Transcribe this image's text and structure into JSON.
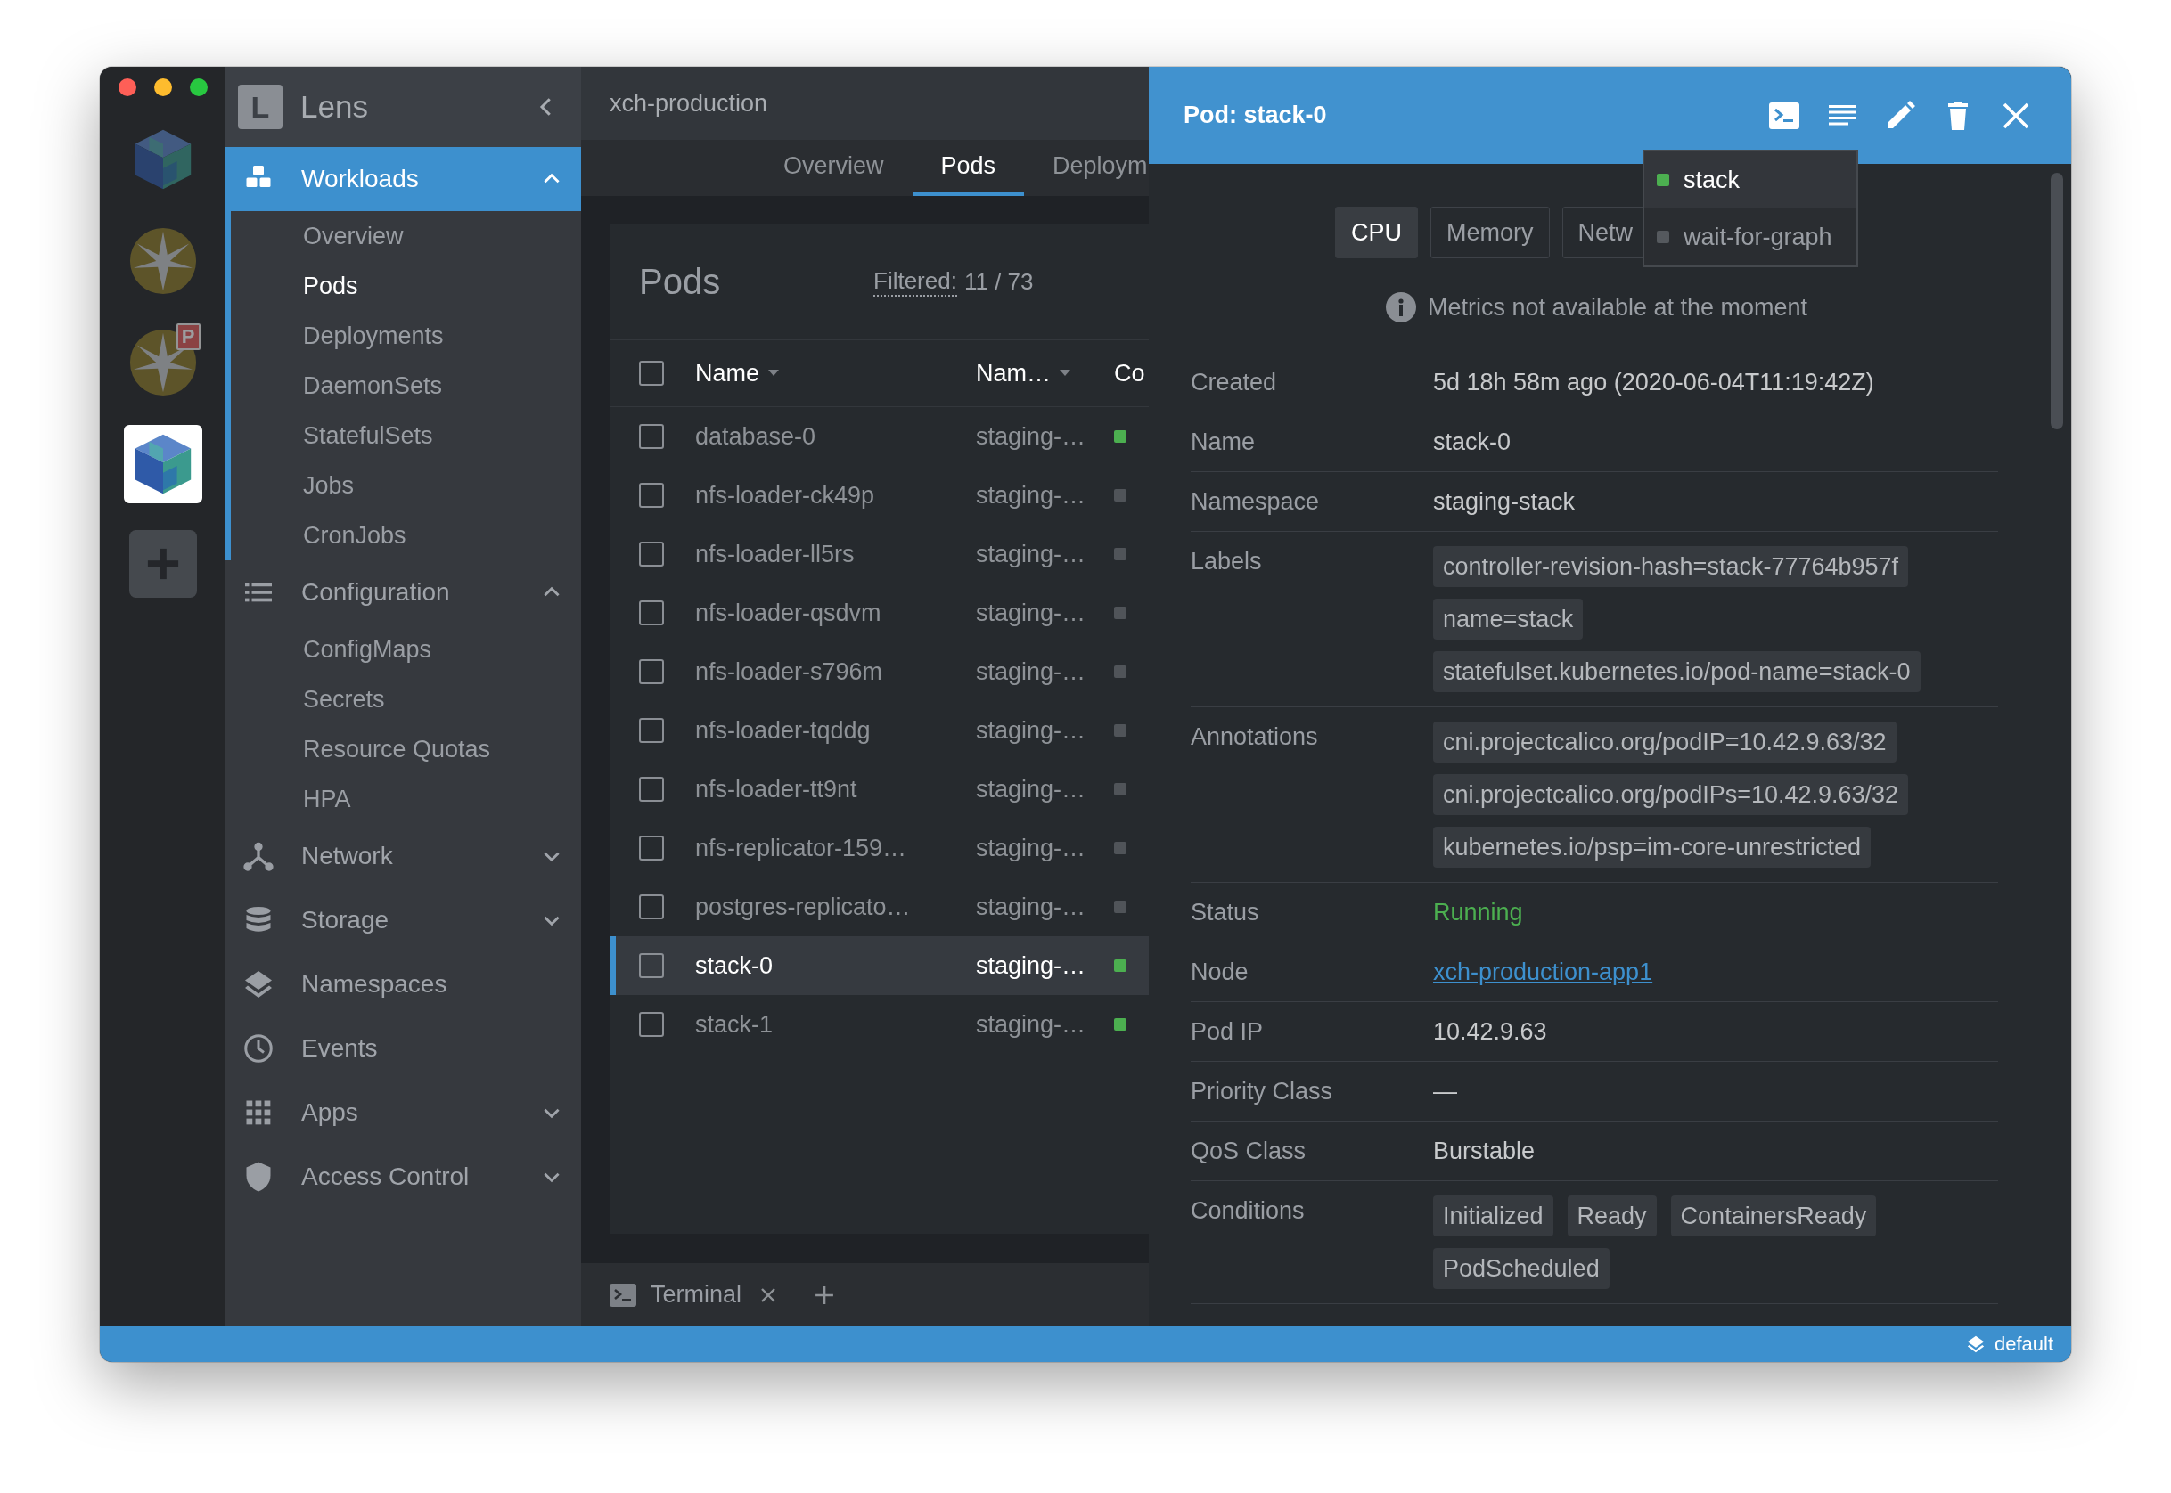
{
  "clusters": [
    {
      "kind": "cube",
      "selected": false
    },
    {
      "kind": "star",
      "selected": false
    },
    {
      "kind": "star",
      "selected": false,
      "badge": "P"
    },
    {
      "kind": "cube",
      "selected": true
    }
  ],
  "sidebar": {
    "logo": "L",
    "title": "Lens",
    "groups": [
      {
        "label": "Workloads",
        "kind": "group",
        "selected": true,
        "expanded": true,
        "children": [
          {
            "label": "Overview",
            "selected": false
          },
          {
            "label": "Pods",
            "selected": true
          },
          {
            "label": "Deployments",
            "selected": false
          },
          {
            "label": "DaemonSets",
            "selected": false
          },
          {
            "label": "StatefulSets",
            "selected": false
          },
          {
            "label": "Jobs",
            "selected": false
          },
          {
            "label": "CronJobs",
            "selected": false
          }
        ]
      },
      {
        "label": "Configuration",
        "kind": "group",
        "selected": false,
        "expanded": true,
        "children": [
          {
            "label": "ConfigMaps",
            "selected": false
          },
          {
            "label": "Secrets",
            "selected": false
          },
          {
            "label": "Resource Quotas",
            "selected": false
          },
          {
            "label": "HPA",
            "selected": false
          }
        ]
      },
      {
        "label": "Network",
        "kind": "group",
        "selected": false,
        "expanded": false
      },
      {
        "label": "Storage",
        "kind": "group",
        "selected": false,
        "expanded": false
      },
      {
        "label": "Namespaces",
        "kind": "link",
        "selected": false
      },
      {
        "label": "Events",
        "kind": "link",
        "selected": false
      },
      {
        "label": "Apps",
        "kind": "group",
        "selected": false,
        "expanded": false
      },
      {
        "label": "Access Control",
        "kind": "group",
        "selected": false,
        "expanded": false
      }
    ]
  },
  "main": {
    "cluster": "xch-production",
    "tabs": [
      {
        "label": "Overview",
        "selected": false
      },
      {
        "label": "Pods",
        "selected": true
      },
      {
        "label": "Deploym",
        "selected": false
      }
    ]
  },
  "pods": {
    "title": "Pods",
    "filter_label": "Filtered:",
    "filter_count": "11 / 73",
    "all_checked": false,
    "columns": [
      {
        "label": "Name",
        "sortable": true
      },
      {
        "label": "Nam…",
        "sortable": true
      },
      {
        "label": "Co",
        "sortable": false
      }
    ],
    "rows": [
      {
        "name": "database-0",
        "namespace": "staging-…",
        "color": "#4caf50",
        "checked": false,
        "selected": false
      },
      {
        "name": "nfs-loader-ck49p",
        "namespace": "staging-…",
        "color": "#505459",
        "checked": false,
        "selected": false
      },
      {
        "name": "nfs-loader-ll5rs",
        "namespace": "staging-…",
        "color": "#505459",
        "checked": false,
        "selected": false
      },
      {
        "name": "nfs-loader-qsdvm",
        "namespace": "staging-…",
        "color": "#505459",
        "checked": false,
        "selected": false
      },
      {
        "name": "nfs-loader-s796m",
        "namespace": "staging-…",
        "color": "#505459",
        "checked": false,
        "selected": false
      },
      {
        "name": "nfs-loader-tqddg",
        "namespace": "staging-…",
        "color": "#505459",
        "checked": false,
        "selected": false
      },
      {
        "name": "nfs-loader-tt9nt",
        "namespace": "staging-…",
        "color": "#505459",
        "checked": false,
        "selected": false
      },
      {
        "name": "nfs-replicator-159…",
        "namespace": "staging-…",
        "color": "#505459",
        "checked": false,
        "selected": false
      },
      {
        "name": "postgres-replicato…",
        "namespace": "staging-…",
        "color": "#505459",
        "checked": false,
        "selected": false
      },
      {
        "name": "stack-0",
        "namespace": "staging-…",
        "color": "#4caf50",
        "checked": false,
        "selected": true
      },
      {
        "name": "stack-1",
        "namespace": "staging-…",
        "color": "#4caf50",
        "checked": false,
        "selected": false
      }
    ]
  },
  "terminal": {
    "label": "Terminal"
  },
  "drawer": {
    "title": "Pod: stack-0",
    "metric_tabs": [
      {
        "label": "CPU",
        "selected": true
      },
      {
        "label": "Memory",
        "selected": false
      },
      {
        "label": "Netw",
        "selected": false
      }
    ],
    "containers": [
      {
        "label": "stack",
        "color": "#4caf50",
        "selected": true
      },
      {
        "label": "wait-for-graph",
        "color": "#55595e",
        "selected": false
      }
    ],
    "notice": "Metrics not available at the moment",
    "details": [
      {
        "label": "Created",
        "kind": "text",
        "value": "5d 18h 58m ago (2020-06-04T11:19:42Z)"
      },
      {
        "label": "Name",
        "kind": "text",
        "value": "stack-0"
      },
      {
        "label": "Namespace",
        "kind": "text",
        "value": "staging-stack"
      },
      {
        "label": "Labels",
        "kind": "badges",
        "badges": [
          "controller-revision-hash=stack-77764b957f",
          "name=stack",
          "statefulset.kubernetes.io/pod-name=stack-0"
        ]
      },
      {
        "label": "Annotations",
        "kind": "badges",
        "badges": [
          "cni.projectcalico.org/podIP=10.42.9.63/32",
          "cni.projectcalico.org/podIPs=10.42.9.63/32",
          "kubernetes.io/psp=im-core-unrestricted"
        ]
      },
      {
        "label": "Status",
        "kind": "status",
        "value": "Running"
      },
      {
        "label": "Node",
        "kind": "link",
        "value": "xch-production-app1"
      },
      {
        "label": "Pod IP",
        "kind": "text",
        "value": "10.42.9.63"
      },
      {
        "label": "Priority Class",
        "kind": "text",
        "value": "—"
      },
      {
        "label": "QoS Class",
        "kind": "text",
        "value": "Burstable"
      },
      {
        "label": "Conditions",
        "kind": "badges",
        "badges": [
          "Initialized",
          "Ready",
          "ContainersReady",
          "PodScheduled"
        ]
      }
    ]
  },
  "status_bar": {
    "context": "default"
  }
}
